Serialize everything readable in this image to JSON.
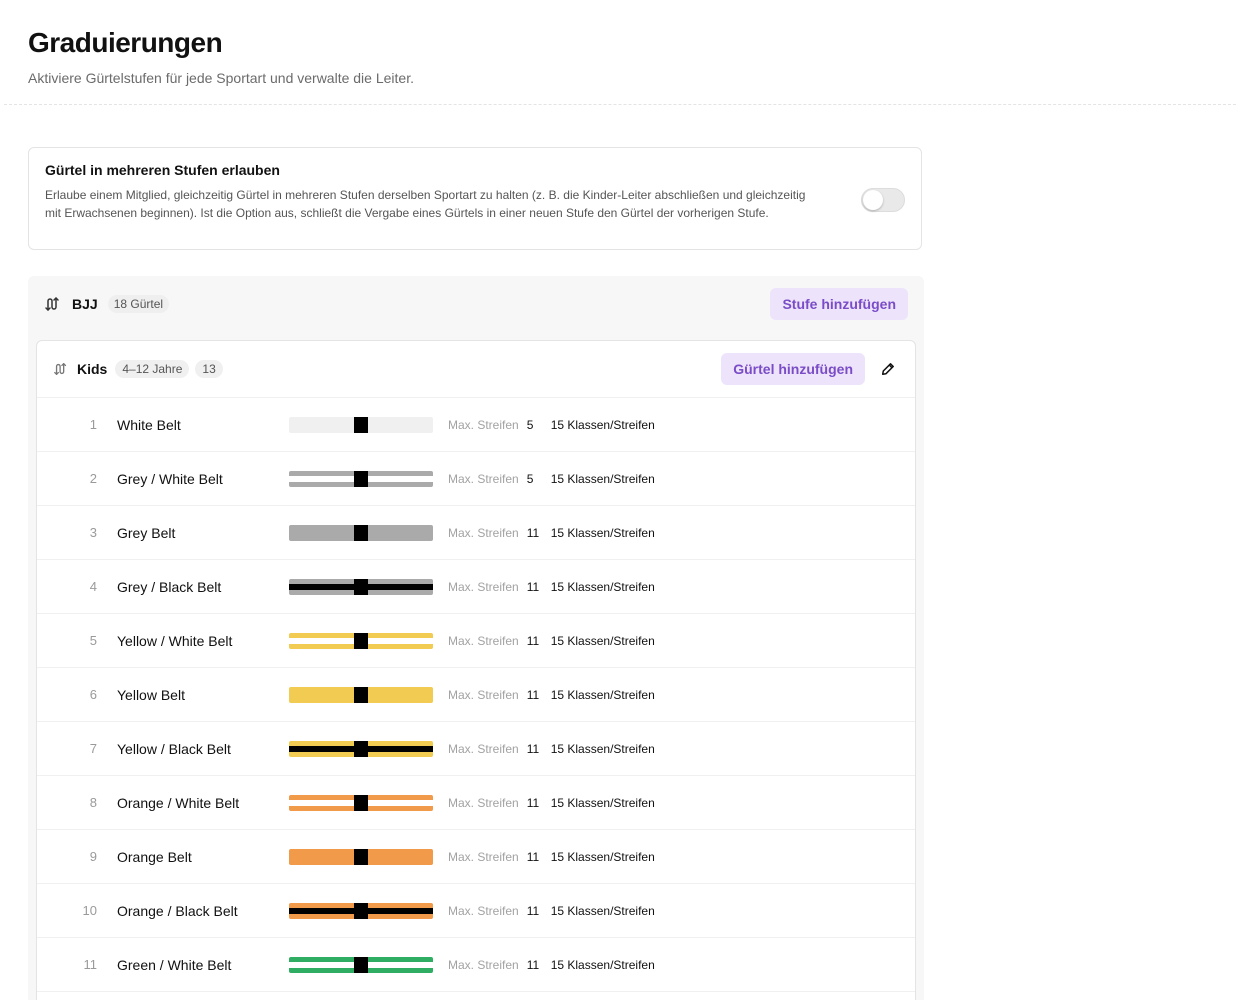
{
  "page": {
    "title": "Graduierungen",
    "subtitle": "Aktiviere Gürtelstufen für jede Sportart und verwalte die Leiter."
  },
  "option": {
    "title": "Gürtel in mehreren Stufen erlauben",
    "description": "Erlaube einem Mitglied, gleichzeitig Gürtel in mehreren Stufen derselben Sportart zu halten (z. B. die Kinder-Leiter abschließen und gleichzeitig mit Erwachsenen beginnen). Ist die Option aus, schließt die Vergabe eines Gürtels in einer neuen Stufe den Gürtel der vorherigen Stufe.",
    "toggle_on": false
  },
  "sport": {
    "name": "BJJ",
    "belt_count": "18 Gürtel",
    "add_level_label": "Stufe hinzufügen"
  },
  "level": {
    "name": "Kids",
    "age_range": "4–12 Jahre",
    "count": "13",
    "add_belt_label": "Gürtel hinzufügen"
  },
  "labels": {
    "max_stripes": "Max. Streifen"
  },
  "colors": {
    "accent_purple": "#7a4cc7",
    "white": "#f0f0f0",
    "grey": "#aaaaaa",
    "yellow": "#f2cc52",
    "orange": "#f09a4a",
    "green": "#2fae63",
    "black": "#000000"
  },
  "belts": [
    {
      "num": "1",
      "name": "White Belt",
      "main": "#f0f0f0",
      "stripe": null,
      "max": "5",
      "classes": "15 Klassen/Streifen"
    },
    {
      "num": "2",
      "name": "Grey / White Belt",
      "main": "#aaaaaa",
      "stripe": "#ffffff",
      "max": "5",
      "classes": "15 Klassen/Streifen"
    },
    {
      "num": "3",
      "name": "Grey Belt",
      "main": "#aaaaaa",
      "stripe": null,
      "max": "11",
      "classes": "15 Klassen/Streifen"
    },
    {
      "num": "4",
      "name": "Grey / Black Belt",
      "main": "#aaaaaa",
      "stripe": "#000000",
      "max": "11",
      "classes": "15 Klassen/Streifen"
    },
    {
      "num": "5",
      "name": "Yellow / White Belt",
      "main": "#f2cc52",
      "stripe": "#ffffff",
      "max": "11",
      "classes": "15 Klassen/Streifen"
    },
    {
      "num": "6",
      "name": "Yellow Belt",
      "main": "#f2cc52",
      "stripe": null,
      "max": "11",
      "classes": "15 Klassen/Streifen"
    },
    {
      "num": "7",
      "name": "Yellow / Black Belt",
      "main": "#f2cc52",
      "stripe": "#000000",
      "max": "11",
      "classes": "15 Klassen/Streifen"
    },
    {
      "num": "8",
      "name": "Orange / White Belt",
      "main": "#f09a4a",
      "stripe": "#ffffff",
      "max": "11",
      "classes": "15 Klassen/Streifen"
    },
    {
      "num": "9",
      "name": "Orange Belt",
      "main": "#f09a4a",
      "stripe": null,
      "max": "11",
      "classes": "15 Klassen/Streifen"
    },
    {
      "num": "10",
      "name": "Orange / Black Belt",
      "main": "#f09a4a",
      "stripe": "#000000",
      "max": "11",
      "classes": "15 Klassen/Streifen"
    },
    {
      "num": "11",
      "name": "Green / White Belt",
      "main": "#2fae63",
      "stripe": "#ffffff",
      "max": "11",
      "classes": "15 Klassen/Streifen"
    },
    {
      "num": "",
      "name": "",
      "main": "#2fae63",
      "stripe": null,
      "max": "",
      "classes": ""
    }
  ]
}
